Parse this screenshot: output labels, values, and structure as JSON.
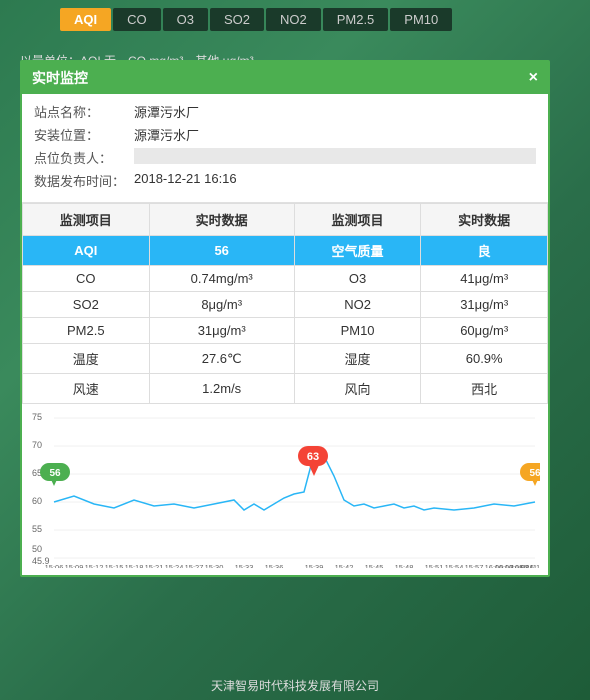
{
  "tabs": [
    {
      "label": "AQI",
      "active": true
    },
    {
      "label": "CO",
      "active": false
    },
    {
      "label": "O3",
      "active": false
    },
    {
      "label": "SO2",
      "active": false
    },
    {
      "label": "NO2",
      "active": false
    },
    {
      "label": "PM2.5",
      "active": false
    },
    {
      "label": "PM10",
      "active": false
    }
  ],
  "legend": "以量单位：AQI 无，CO mg/m³，其他 μg/m³",
  "modal": {
    "title": "实时监控",
    "close": "×",
    "info": {
      "station_label": "站点名称：",
      "station_value": "源潭污水厂",
      "location_label": "安装位置：",
      "location_value": "源潭污水厂",
      "contact_label": "点位负责人：",
      "contact_value": "",
      "time_label": "数据发布时间：",
      "time_value": "2018-12-21 16:16"
    },
    "table": {
      "headers": [
        "监测项目",
        "实时数据",
        "监测项目",
        "实时数据"
      ],
      "rows": [
        {
          "col1": "AQI",
          "col2": "56",
          "col3": "空气质量",
          "col4": "良",
          "highlight": true
        },
        {
          "col1": "CO",
          "col2": "0.74mg/m³",
          "col3": "O3",
          "col4": "41μg/m³",
          "highlight": false
        },
        {
          "col1": "SO2",
          "col2": "8μg/m³",
          "col3": "NO2",
          "col4": "31μg/m³",
          "highlight": false
        },
        {
          "col1": "PM2.5",
          "col2": "31μg/m³",
          "col3": "PM10",
          "col4": "60μg/m³",
          "highlight": false
        },
        {
          "col1": "温度",
          "col2": "27.6℃",
          "col3": "湿度",
          "col4": "60.9%",
          "highlight": false
        },
        {
          "col1": "风速",
          "col2": "1.2m/s",
          "col3": "风向",
          "col4": "西北",
          "highlight": false
        }
      ]
    }
  },
  "chart": {
    "y_min": 45.9,
    "y_max": 75,
    "y_labels": [
      "75",
      "70",
      "65",
      "60",
      "55",
      "50",
      "45.9"
    ],
    "x_labels": [
      "15:06",
      "15:09",
      "15:12",
      "15:15",
      "15:18",
      "15:21",
      "15:24",
      "15:27",
      "15:30",
      "15:33",
      "15:36",
      "15:39",
      "15:42",
      "15:45",
      "15:48",
      "15:51",
      "15:54",
      "15:57",
      "16:00",
      "16:03",
      "16:06",
      "16:08",
      "16:11",
      "16:14"
    ],
    "markers": [
      {
        "label": "56",
        "color": "#4CAF50",
        "type": "start"
      },
      {
        "label": "63",
        "color": "#f44336",
        "type": "peak"
      },
      {
        "label": "56",
        "color": "#f5a623",
        "type": "end"
      }
    ]
  },
  "footer": "天津智易时代科技发展有限公司"
}
